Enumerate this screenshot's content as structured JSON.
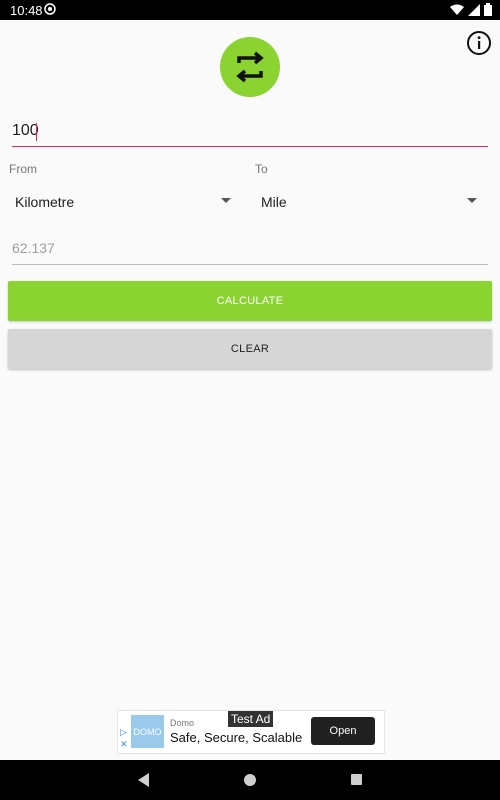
{
  "colors": {
    "accent": "#8bd331",
    "input_underline": "#e91e63"
  },
  "status_bar": {
    "time": "10:48"
  },
  "app": {
    "logo_icon": "swap-arrows-icon",
    "info_icon": "info-icon",
    "amount": {
      "value": "100",
      "placeholder": ""
    },
    "from": {
      "label": "From",
      "selected": "Kilometre"
    },
    "to": {
      "label": "To",
      "selected": "Mile"
    },
    "result": "62.137",
    "calculate_label": "CALCULATE",
    "clear_label": "CLEAR"
  },
  "ad": {
    "badge": "Test Ad",
    "brand": "Domo",
    "logo_text": "DOMO",
    "headline": "Safe, Secure, Scalable",
    "cta": "Open"
  }
}
